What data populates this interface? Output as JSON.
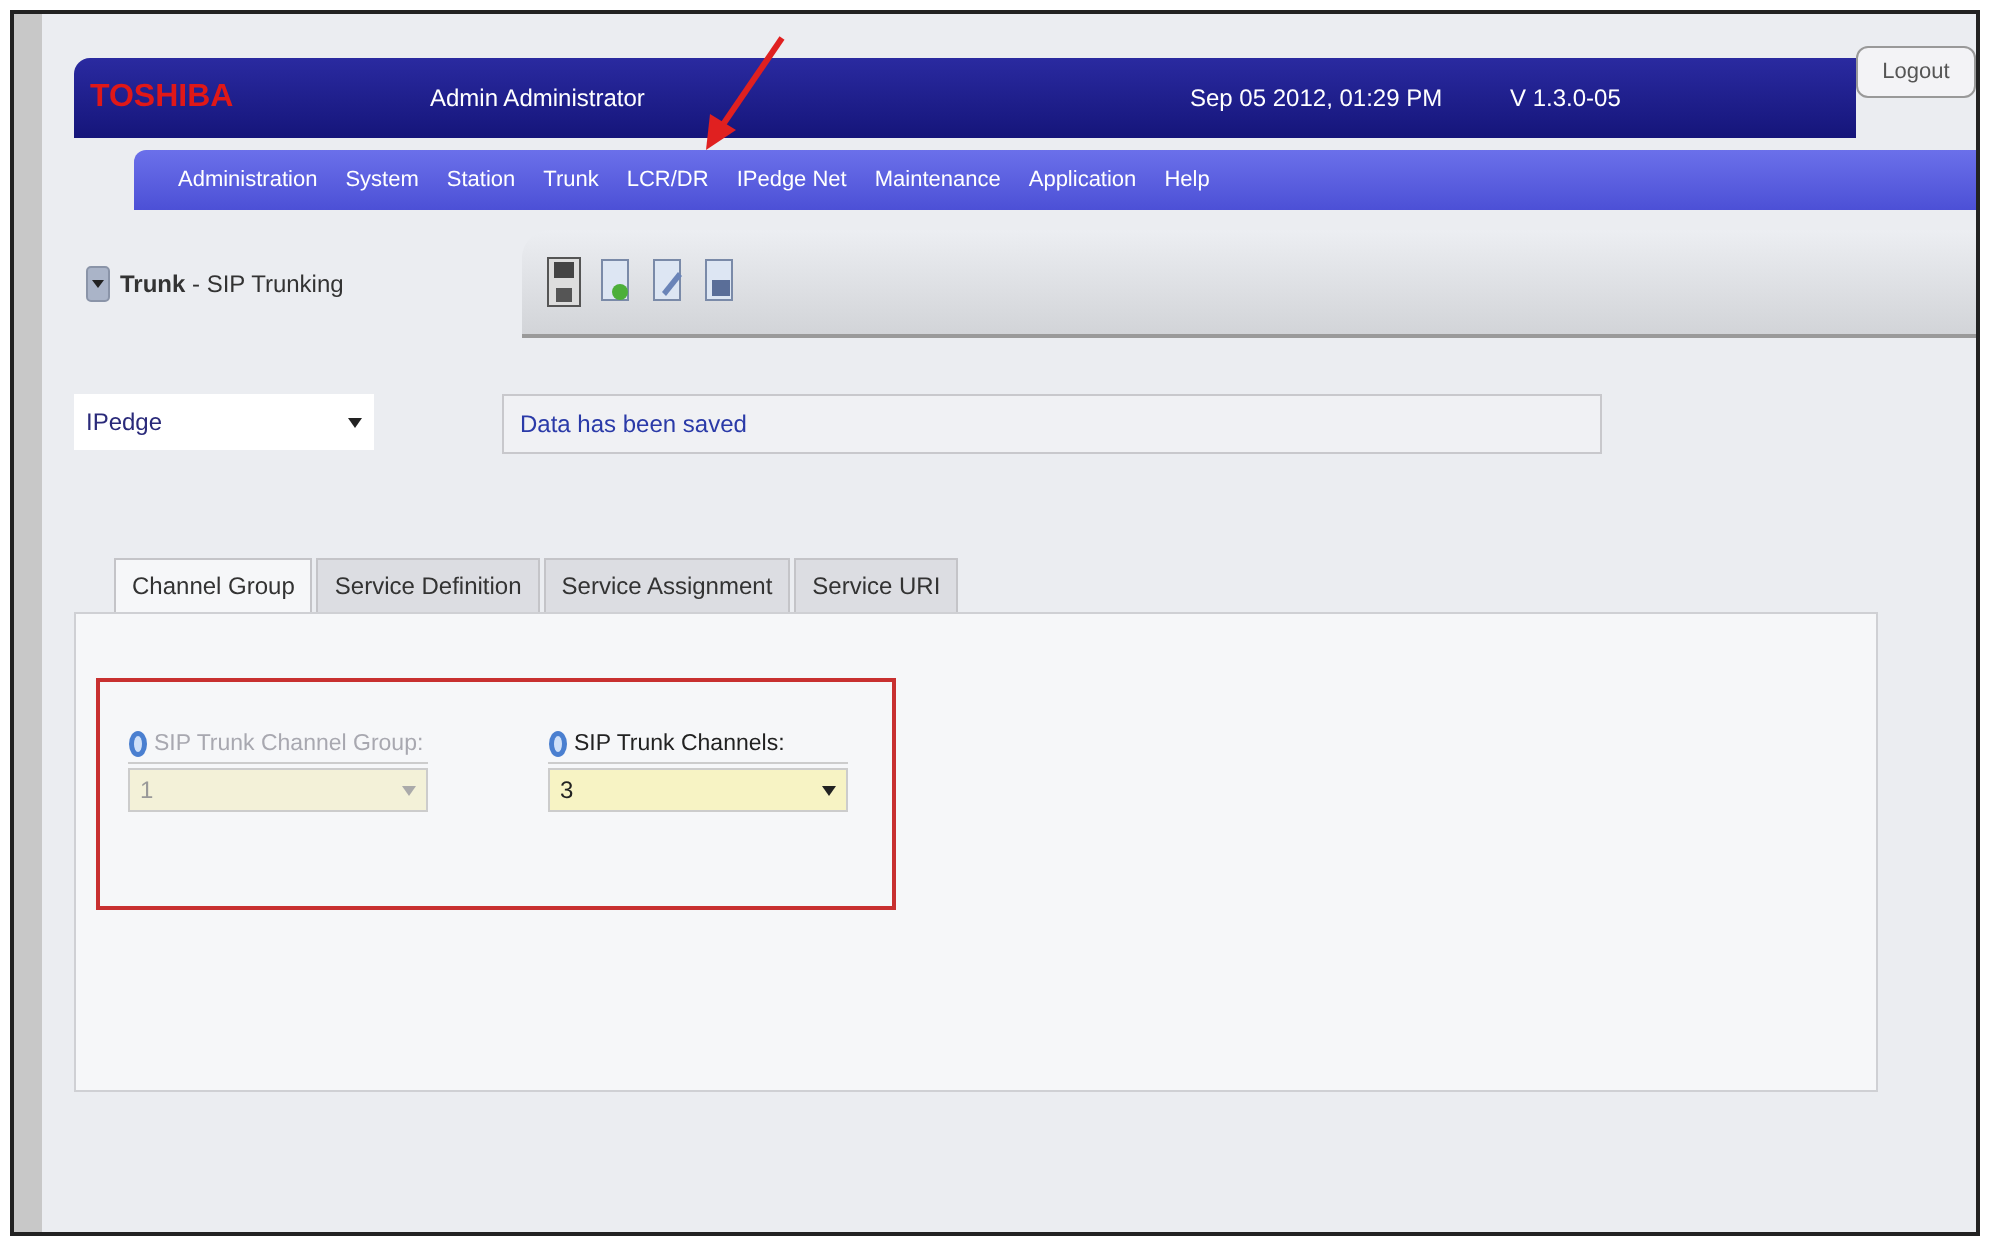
{
  "header": {
    "logo": "TOSHIBA",
    "user": "Admin  Administrator",
    "datetime": "Sep 05 2012, 01:29 PM",
    "version": "V 1.3.0-05",
    "logout": "Logout"
  },
  "menu": [
    "Administration",
    "System",
    "Station",
    "Trunk",
    "LCR/DR",
    "IPedge Net",
    "Maintenance",
    "Application",
    "Help"
  ],
  "breadcrumb": "**Trunk** - SIP Trunking",
  "node_select": {
    "value": "IPedge"
  },
  "message": "Data has been saved",
  "tabs": [
    {
      "label": "Channel Group",
      "selected": true
    },
    {
      "label": "Service Definition",
      "selected": false
    },
    {
      "label": "Service Assignment",
      "selected": false
    },
    {
      "label": "Service URI",
      "selected": false
    }
  ],
  "fields": [
    {
      "label": "SIP Trunk Channel Group:",
      "value": "1",
      "disabled": true
    },
    {
      "label": "SIP Trunk Channels:",
      "value": "3",
      "disabled": false
    }
  ]
}
